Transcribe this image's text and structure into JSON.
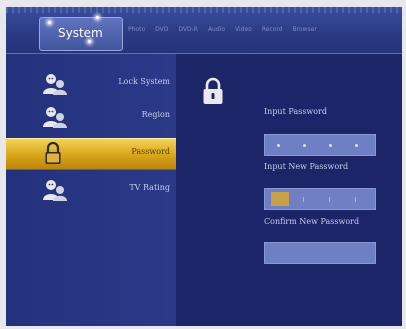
{
  "header": {
    "active_tab": "System",
    "tabs": [
      "Photo",
      "DVD",
      "DVD-R",
      "Audio",
      "Video",
      "Record",
      "Browser"
    ]
  },
  "sidebar": {
    "items": [
      {
        "label": "Lock System",
        "icon": "user-icon",
        "selected": false
      },
      {
        "label": "Region",
        "icon": "user-icon",
        "selected": false
      },
      {
        "label": "Password",
        "icon": "lock-icon",
        "selected": true
      },
      {
        "label": "TV Rating",
        "icon": "user-icon",
        "selected": false
      }
    ]
  },
  "content": {
    "icon": "lock-icon",
    "input_password_label": "Input Password",
    "input_new_password_label": "Input New Password",
    "confirm_new_password_label": "Confirm New Password"
  },
  "colors": {
    "background": "#1a2466",
    "selected_item": "#d8a418",
    "field_box": "#6e7fc4",
    "text": "#c7cdeb"
  }
}
